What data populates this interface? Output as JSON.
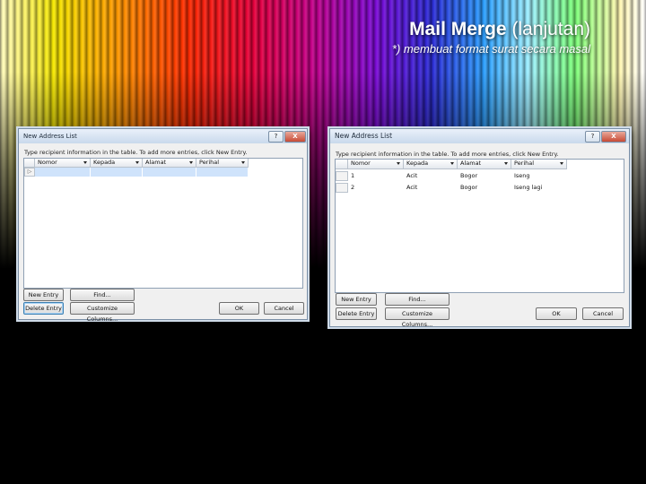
{
  "slide": {
    "title_bold": "Mail Merge",
    "title_rest": "(lanjutan)",
    "subtitle": "*) membuat format surat secara masal"
  },
  "dialog_left": {
    "title": "New Address List",
    "help": "?",
    "close": "X",
    "instruction": "Type recipient information in the table.  To add more entries, click New Entry.",
    "columns": [
      "Nomor",
      "Kepada",
      "Alamat",
      "Perihal"
    ],
    "new_entry_marker": "▷",
    "buttons": {
      "new_entry": "New Entry",
      "delete_entry": "Delete Entry",
      "find": "Find...",
      "customize": "Customize Columns...",
      "ok": "OK",
      "cancel": "Cancel"
    }
  },
  "dialog_right": {
    "title": "New Address List",
    "help": "?",
    "close": "X",
    "instruction": "Type recipient information in the table.  To add more entries, click New Entry.",
    "columns": [
      "Nomor",
      "Kepada",
      "Alamat",
      "Perihal"
    ],
    "rows": [
      [
        "1",
        "Acit",
        "Bogor",
        "Iseng"
      ],
      [
        "2",
        "Acit",
        "Bogor",
        "Iseng lagi"
      ]
    ],
    "buttons": {
      "new_entry": "New Entry",
      "delete_entry": "Delete Entry",
      "find": "Find...",
      "customize": "Customize Columns...",
      "ok": "OK",
      "cancel": "Cancel"
    }
  }
}
